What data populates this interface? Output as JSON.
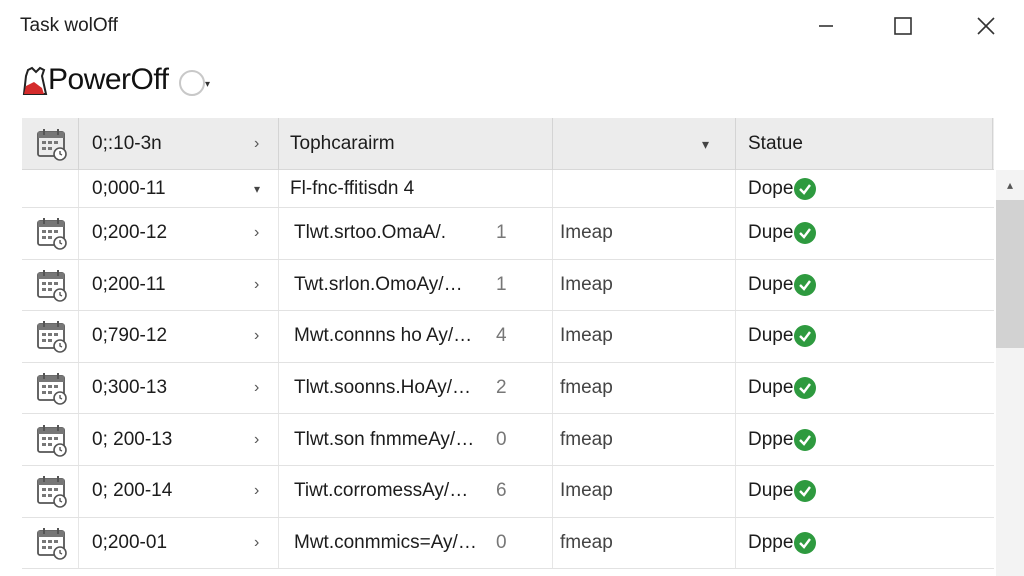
{
  "window": {
    "title": "Task wolOff"
  },
  "app": {
    "name": "PowerOff",
    "caret": "▾",
    "icons": [
      "app-logo-icon",
      "status-circle-icon",
      "calendar-icon",
      "check-circle-icon"
    ]
  },
  "table": {
    "header": {
      "date": "0;:10-3n",
      "date_chevron": "›",
      "topic": "Tophcarairm",
      "sort_caret": "▾",
      "status": "Statue"
    },
    "group_row": {
      "date": "0;000-11",
      "caret": "▾",
      "topic": "Fl-fnc-ffitisdn 4",
      "status": "Dope"
    },
    "rows": [
      {
        "date": "0;200-12",
        "chevron": "›",
        "name": "Tlwt.srtoo.OmaA/​.",
        "count": "1",
        "type": "Imeap",
        "status": "Dupe"
      },
      {
        "date": "0;200-11",
        "chevron": "›",
        "name": "Twt.srlon.OmoAy/…",
        "count": "1",
        "type": "Imeap",
        "status": "Dupe"
      },
      {
        "date": "0;790-12",
        "chevron": "›",
        "name": "Mwt.connns ho Ay/…",
        "count": "4",
        "type": "Imeap",
        "status": "Dupe"
      },
      {
        "date": "0;300-13",
        "chevron": "›",
        "name": "Tlwt.soonns.HoAy/…",
        "count": "2",
        "type": "fmeap",
        "status": "Dupe"
      },
      {
        "date": "0; 200-13",
        "chevron": "›",
        "name": "Tlwt.son fnmmeAy/…",
        "count": "0",
        "type": "fmeap",
        "status": "Dppe"
      },
      {
        "date": "0; 200-14",
        "chevron": "›",
        "name": "Tiwt.corromessAy/…",
        "count": "6",
        "type": "Imeap",
        "status": "Dupe"
      },
      {
        "date": "0;200-01",
        "chevron": "›",
        "name": "Mwt.conmmics=Ay/…",
        "count": "0",
        "type": "fmeap",
        "status": "Dppe"
      }
    ]
  },
  "scrollbar": {
    "up_arrow": "▴"
  },
  "colors": {
    "header_bg": "#ececec",
    "check_green": "#2e9a3f",
    "logo_red": "#d42b2b"
  }
}
